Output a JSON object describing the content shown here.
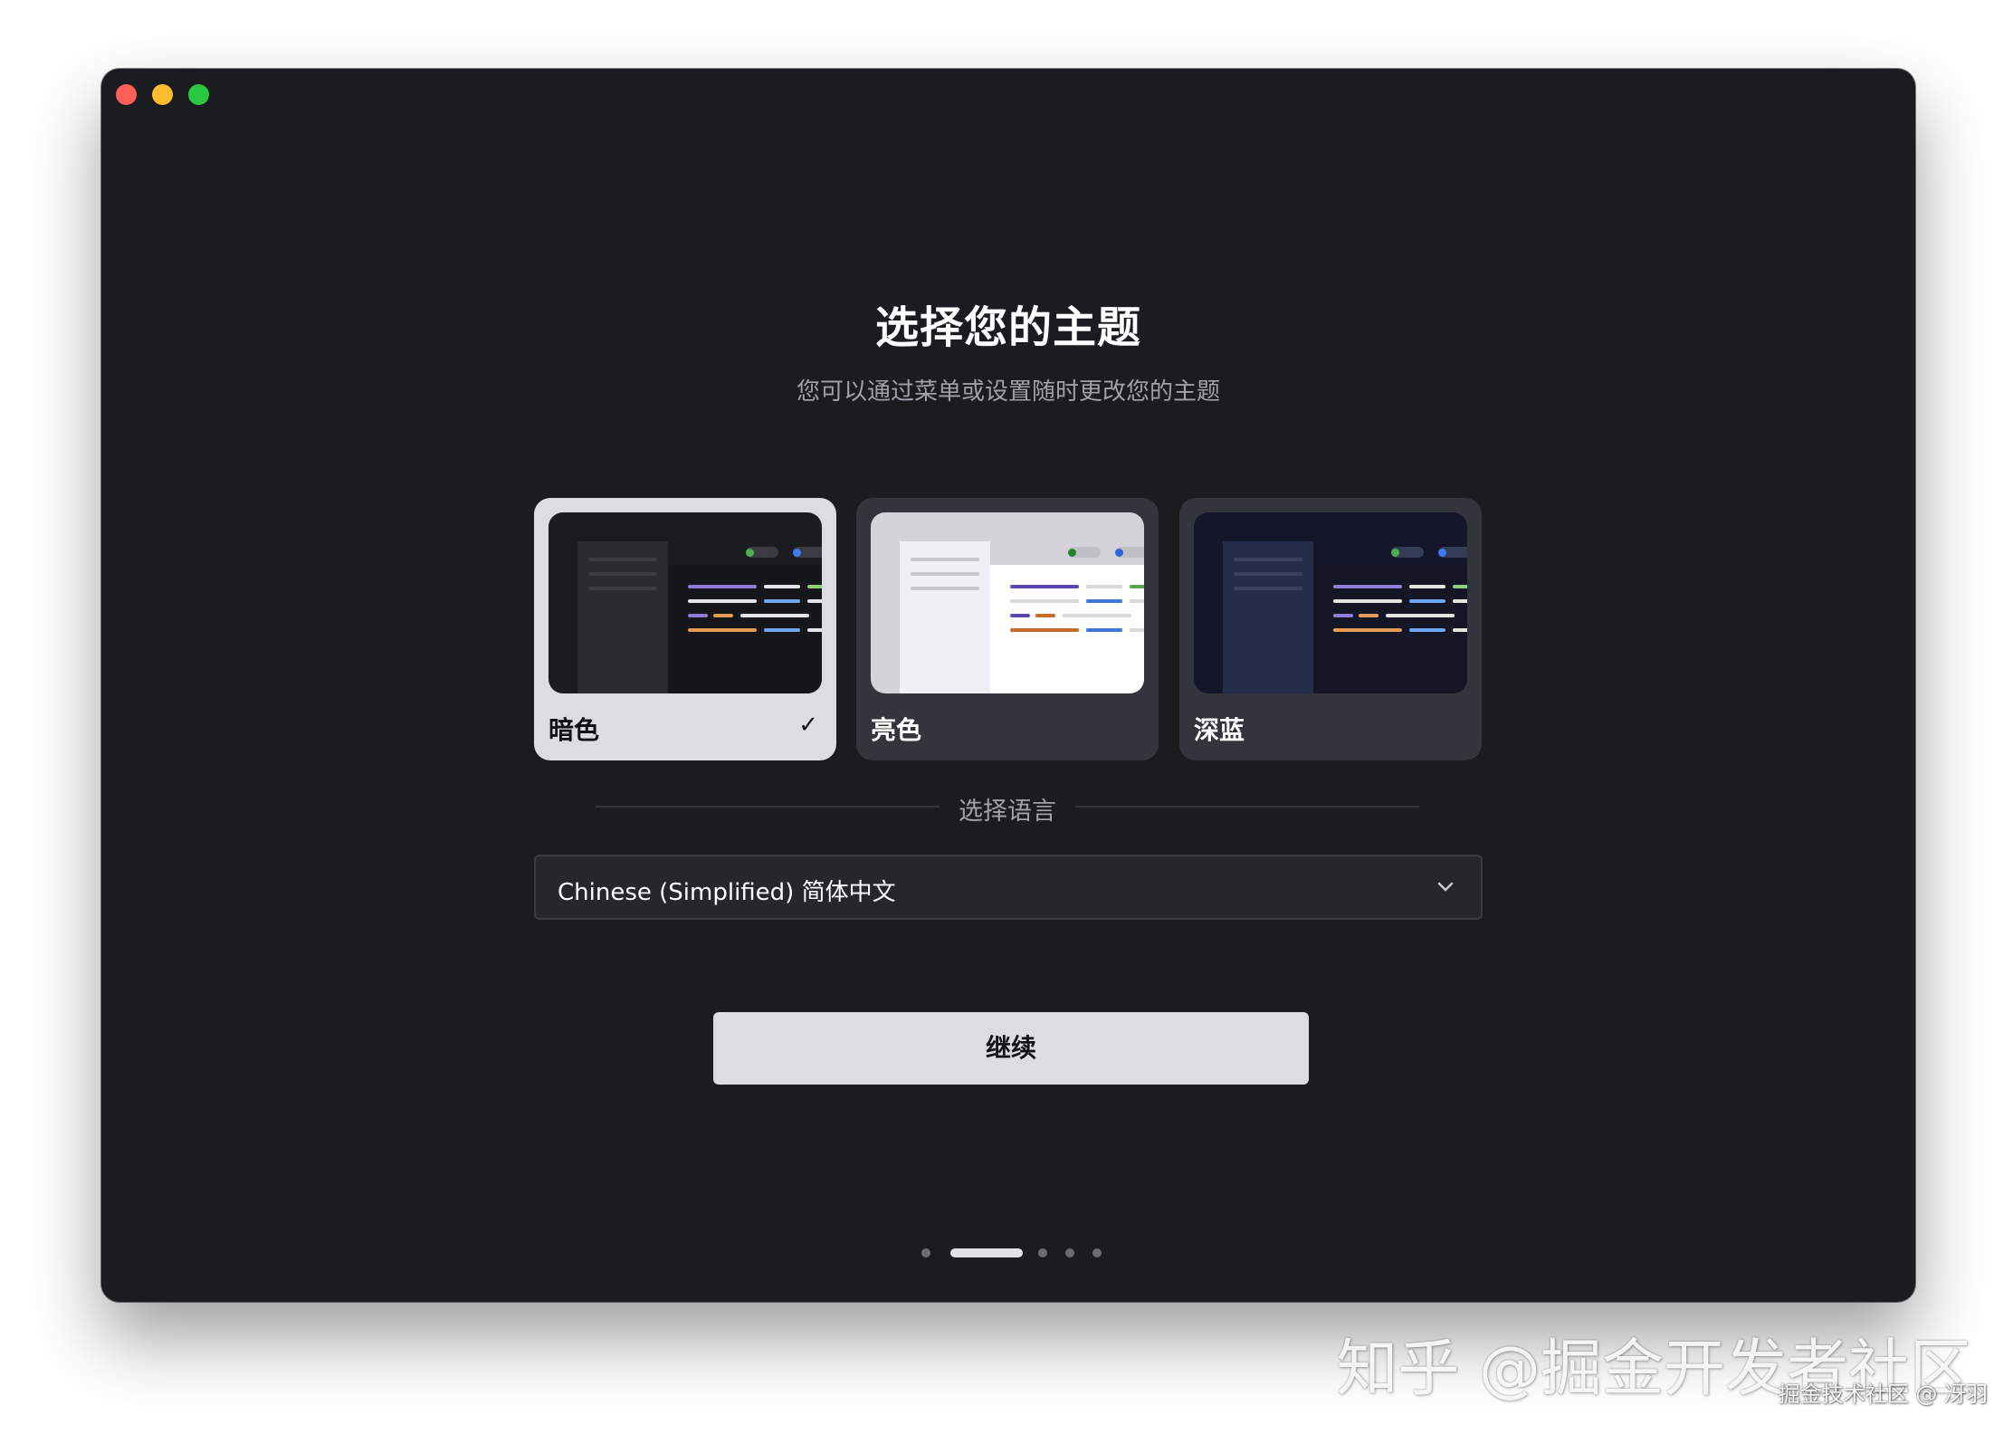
{
  "window": {
    "title": "选择您的主题",
    "subtitle": "您可以通过菜单或设置随时更改您的主题"
  },
  "themes": [
    {
      "label": "暗色",
      "selected": true,
      "check": "✓"
    },
    {
      "label": "亮色",
      "selected": false
    },
    {
      "label": "深蓝",
      "selected": false
    }
  ],
  "language": {
    "section_label": "选择语言",
    "selected_value": "Chinese (Simplified) 简体中文"
  },
  "continue_label": "继续",
  "pagination": {
    "total": 5,
    "current": 2
  },
  "watermark": {
    "main": "知乎 @掘金开发者社区",
    "sub": "掘金技术社区 @ 冴羽"
  },
  "colors": {
    "window_bg": "#1b1c20",
    "card_selected_bg": "#dcdde3",
    "card_bg": "#33353c",
    "button_bg": "#dcdde3",
    "traffic_close": "#fe5f57",
    "traffic_minimize": "#febc2e",
    "traffic_maximize": "#28c840"
  }
}
